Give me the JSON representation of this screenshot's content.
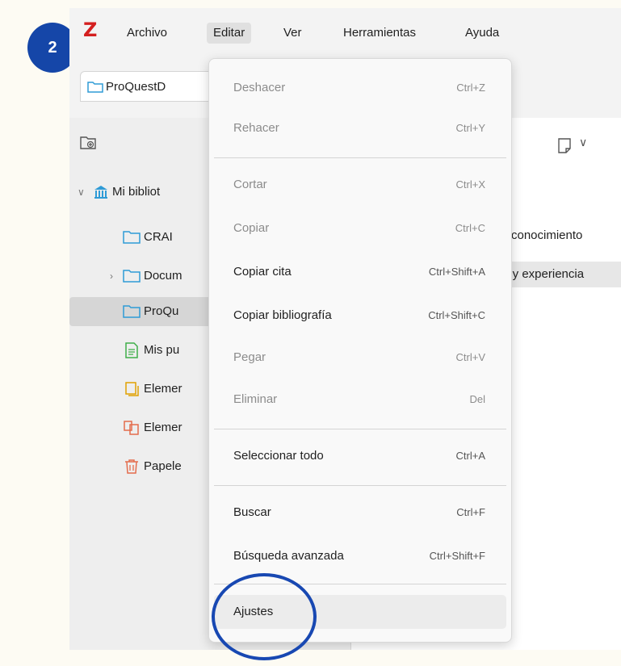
{
  "step_number": "2",
  "menubar": {
    "logo": "Z",
    "items": [
      "Archivo",
      "Editar",
      "Ver",
      "Herramientas",
      "Ayuda"
    ],
    "active": "Editar"
  },
  "tab": {
    "label": "ProQuestD"
  },
  "sidebar": {
    "library": "Mi bibliot",
    "items": [
      {
        "label": "CRAI",
        "icon": "folder-icon"
      },
      {
        "label": "Docum",
        "icon": "folder-icon"
      },
      {
        "label": "ProQu",
        "icon": "folder-icon"
      },
      {
        "label": "Mis pu",
        "icon": "my-publications-icon"
      },
      {
        "label": "Elemer",
        "icon": "unfiled-items-icon"
      },
      {
        "label": "Elemer",
        "icon": "duplicate-items-icon"
      },
      {
        "label": "Papele",
        "icon": "trash-icon"
      }
    ]
  },
  "main": {
    "rows": [
      "conocimiento",
      "s y experiencia"
    ]
  },
  "edit_menu": {
    "items": [
      {
        "label": "Deshacer",
        "shortcut": "Ctrl+Z",
        "enabled": false
      },
      {
        "label": "Rehacer",
        "shortcut": "Ctrl+Y",
        "enabled": false
      },
      {
        "label": "Cortar",
        "shortcut": "Ctrl+X",
        "enabled": false
      },
      {
        "label": "Copiar",
        "shortcut": "Ctrl+C",
        "enabled": false
      },
      {
        "label": "Copiar cita",
        "shortcut": "Ctrl+Shift+A",
        "enabled": true
      },
      {
        "label": "Copiar bibliografía",
        "shortcut": "Ctrl+Shift+C",
        "enabled": true
      },
      {
        "label": "Pegar",
        "shortcut": "Ctrl+V",
        "enabled": false
      },
      {
        "label": "Eliminar",
        "shortcut": "Del",
        "enabled": false
      },
      {
        "label": "Seleccionar todo",
        "shortcut": "Ctrl+A",
        "enabled": true
      },
      {
        "label": "Buscar",
        "shortcut": "Ctrl+F",
        "enabled": true
      },
      {
        "label": "Búsqueda avanzada",
        "shortcut": "Ctrl+Shift+F",
        "enabled": true
      },
      {
        "label": "Ajustes",
        "shortcut": "",
        "enabled": true,
        "highlighted": true
      }
    ]
  },
  "colors": {
    "accent": "#1546a8",
    "logo": "#d42020",
    "folder": "#2f9bd6"
  }
}
